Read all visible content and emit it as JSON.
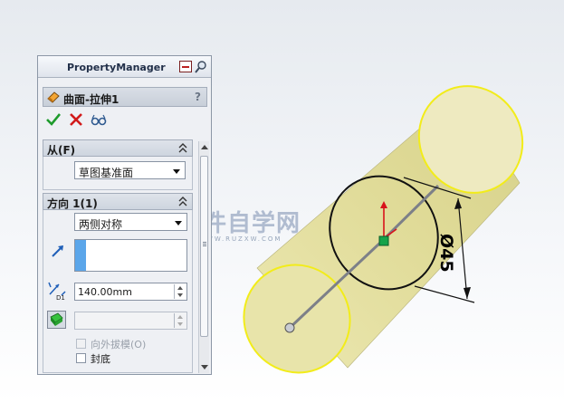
{
  "property_manager": {
    "title": "PropertyManager",
    "feature_title": "曲面-拉伸1",
    "help_label": "?",
    "from_section": {
      "title": "从(F)",
      "start_condition": "草图基准面"
    },
    "direction_section": {
      "title": "方向 1(1)",
      "end_condition": "两侧对称",
      "depth_value": "140.00mm",
      "draft_outward_label": "向外拔模(O)",
      "cap_end_label": "封底"
    }
  },
  "viewport": {
    "watermark_main": "软件自学网",
    "watermark_sub": "WWW.RUZXW.COM",
    "dimension_label": "Ø45",
    "colors": {
      "surface_fill": "#e6e2a6",
      "edge_highlight": "#f2ec1a",
      "sketch_line": "#111111",
      "background_top": "#e6eaef"
    }
  },
  "icons": {
    "pin": "pin-icon",
    "search": "magnifier-icon",
    "feature": "extrude-surface-icon",
    "ok": "checkmark-icon",
    "cancel": "cross-icon",
    "preview": "glasses-icon",
    "direction": "arrow-icon",
    "depth": "dimension-icon",
    "draft": "draft-icon"
  }
}
